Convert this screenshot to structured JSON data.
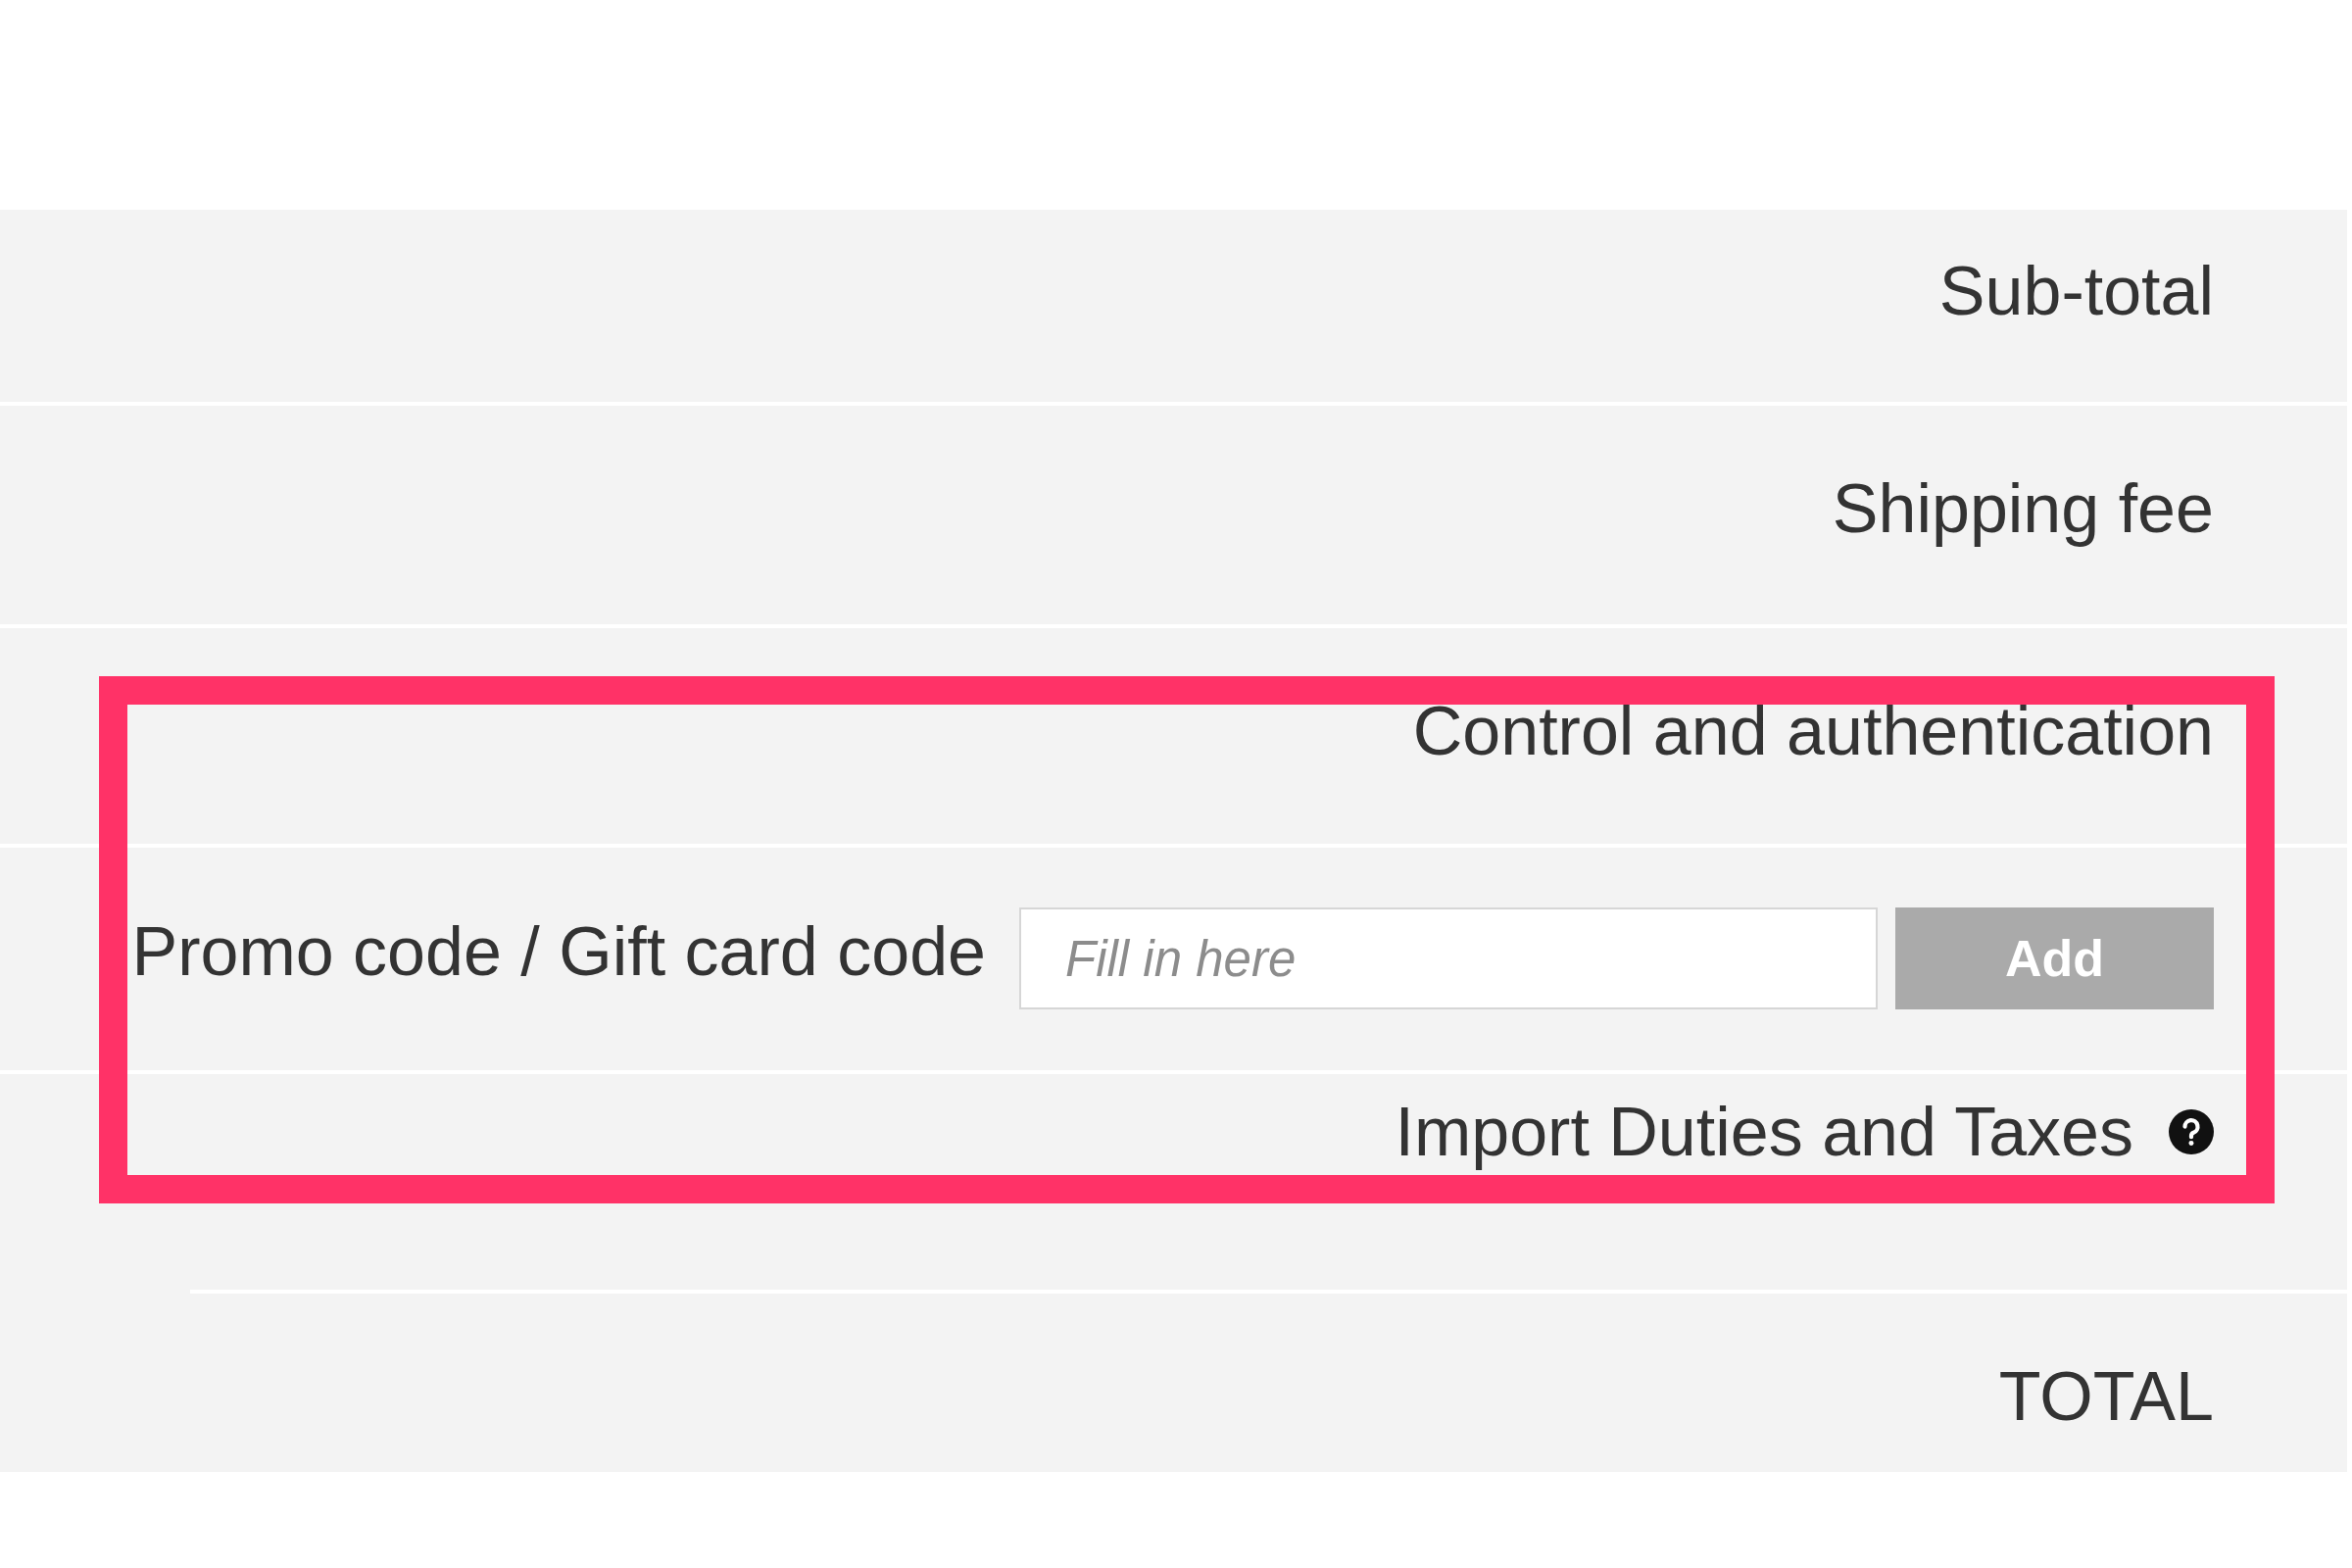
{
  "summary_rows": [
    {
      "kind": "label",
      "label": "Sub-total"
    },
    {
      "kind": "label",
      "label": "Shipping fee"
    },
    {
      "kind": "label",
      "label": "Control and authentication"
    },
    {
      "kind": "promo",
      "label": "Promo code / Gift card code",
      "input": {
        "placeholder": "Fill in here"
      },
      "button": "Add"
    },
    {
      "kind": "label_help",
      "label": "Import Duties and Taxes"
    },
    {
      "kind": "total",
      "label": "TOTAL"
    }
  ]
}
